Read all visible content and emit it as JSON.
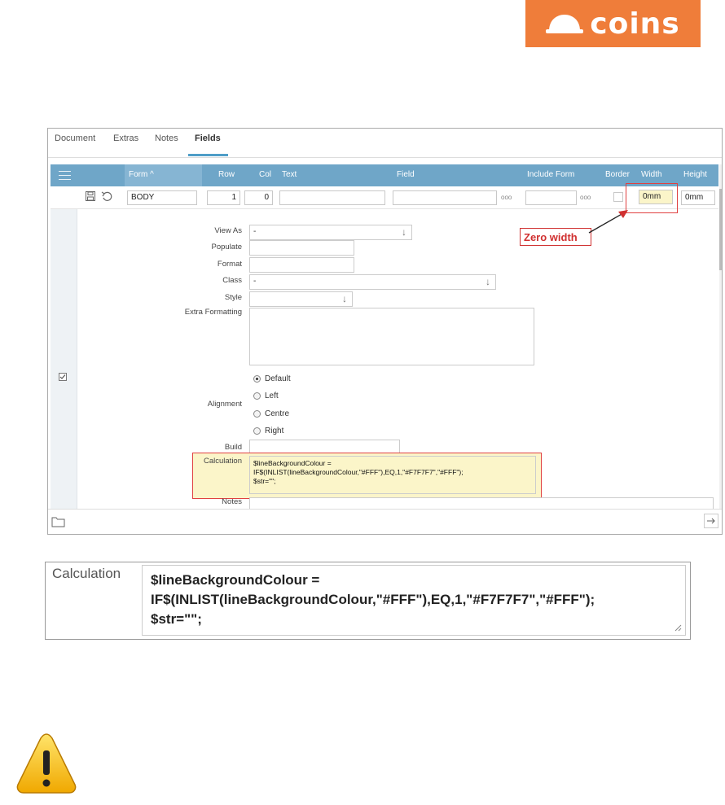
{
  "logo": {
    "text": "coins",
    "color": "#ef7d3a"
  },
  "tabs": [
    {
      "label": "Document",
      "active": false
    },
    {
      "label": "Extras",
      "active": false
    },
    {
      "label": "Notes",
      "active": false
    },
    {
      "label": "Fields",
      "active": true
    }
  ],
  "grid_header": {
    "form": "Form ^",
    "row": "Row",
    "col": "Col",
    "text": "Text",
    "field": "Field",
    "include_form": "Include Form",
    "border": "Border",
    "width": "Width",
    "height": "Height"
  },
  "record": {
    "form": "BODY",
    "row": "1",
    "col": "0",
    "text": "",
    "field": "",
    "include_form": "",
    "width": "0mm",
    "height": "0mm",
    "ellipsis": "ooo"
  },
  "fields": {
    "view_as_label": "View As",
    "view_as_value": "-",
    "populate_label": "Populate",
    "format_label": "Format",
    "class_label": "Class",
    "class_value": "-",
    "style_label": "Style",
    "extra_formatting_label": "Extra Formatting",
    "alignment_label": "Alignment",
    "alignment_options": [
      "Default",
      "Left",
      "Centre",
      "Right"
    ],
    "alignment_selected": "Default",
    "build_label": "Build",
    "calculation_label": "Calculation",
    "calculation_value": "$lineBackgroundColour =\nIF$(INLIST(lineBackgroundColour,\"#FFF\"),EQ,1,\"#F7F7F7\",\"#FFF\");\n$str=\"\";",
    "notes_label": "Notes"
  },
  "annotation": {
    "callout": "Zero width",
    "color": "#d03030"
  },
  "zoom": {
    "label": "Calculation",
    "value": "$lineBackgroundColour =\nIF$(INLIST(lineBackgroundColour,\"#FFF\"),EQ,1,\"#F7F7F7\",\"#FFF\");\n$str=\"\";"
  },
  "icons": {
    "save": "save-icon",
    "undo": "undo-icon",
    "menu": "hamburger-menu-icon",
    "checkbox": "checkbox-icon",
    "folder": "folder-icon",
    "next": "arrow-right-icon",
    "warning": "warning-icon"
  }
}
